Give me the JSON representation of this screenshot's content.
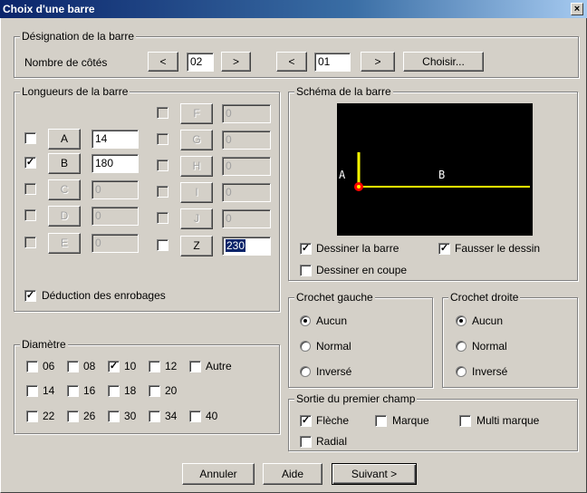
{
  "window": {
    "title": "Choix d'une barre",
    "close_icon": "×"
  },
  "designation": {
    "legend": "Désignation de la barre",
    "nombre_label": "Nombre de côtés",
    "prev1": "<",
    "value1": "02",
    "next1": ">",
    "prev2": "<",
    "value2": "01",
    "next2": ">",
    "choisir": "Choisir..."
  },
  "longueurs": {
    "legend": "Longueurs de la barre",
    "rows": [
      {
        "label": "A",
        "value": "14",
        "checked": false
      },
      {
        "label": "B",
        "value": "180",
        "checked": true
      },
      {
        "label": "C",
        "value": "0",
        "checked": false
      },
      {
        "label": "D",
        "value": "0",
        "checked": false
      },
      {
        "label": "E",
        "value": "0",
        "checked": false
      },
      {
        "label": "F",
        "value": "0",
        "checked": false
      },
      {
        "label": "G",
        "value": "0",
        "checked": false
      },
      {
        "label": "H",
        "value": "0",
        "checked": false
      },
      {
        "label": "I",
        "value": "0",
        "checked": false
      },
      {
        "label": "J",
        "value": "0",
        "checked": false
      },
      {
        "label": "Z",
        "value": "230",
        "checked": false
      }
    ],
    "deduction_label": "Déduction des enrobages",
    "deduction_checked": true
  },
  "schema": {
    "legend": "Schéma de la barre",
    "label_a": "A",
    "label_b": "B",
    "dessiner_barre": "Dessiner la barre",
    "dessiner_barre_checked": true,
    "fausser": "Fausser le dessin",
    "fausser_checked": true,
    "coupe": "Dessiner en coupe",
    "coupe_checked": false,
    "line_color": "#ffff00",
    "dot_color": "#ff0000"
  },
  "crochet_gauche": {
    "legend": "Crochet gauche",
    "options": [
      "Aucun",
      "Normal",
      "Inversé"
    ],
    "selected": 0
  },
  "crochet_droite": {
    "legend": "Crochet droite",
    "options": [
      "Aucun",
      "Normal",
      "Inversé"
    ],
    "selected": 0
  },
  "diametre": {
    "legend": "Diamètre",
    "row1": [
      "06",
      "08",
      "10",
      "12",
      "Autre"
    ],
    "row2": [
      "14",
      "16",
      "18",
      "20"
    ],
    "row3": [
      "22",
      "26",
      "30",
      "34",
      "40"
    ],
    "checked": "10"
  },
  "sortie": {
    "legend": "Sortie du premier champ",
    "fleche": "Flèche",
    "fleche_checked": true,
    "marque": "Marque",
    "marque_checked": false,
    "multi": "Multi marque",
    "multi_checked": false,
    "radial": "Radial",
    "radial_checked": false
  },
  "footer": {
    "annuler": "Annuler",
    "aide": "Aide",
    "suivant": "Suivant >"
  },
  "check_glyph": "✓"
}
